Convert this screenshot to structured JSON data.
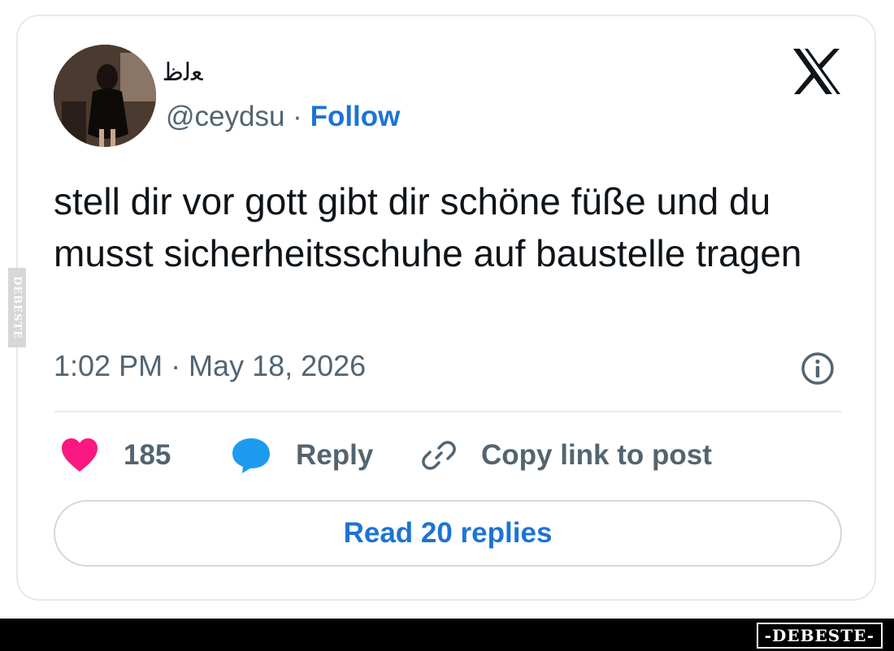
{
  "tweet": {
    "display_name": "ﻌﻟﻇ",
    "handle": "@ceydsu",
    "separator": "·",
    "follow_label": "Follow",
    "text": "stell dir vor gott gibt dir schöne füße und du musst sicherheitsschuhe auf baustelle tragen",
    "timestamp": "1:02 PM · May 18, 2026"
  },
  "actions": {
    "like_count": "185",
    "reply_label": "Reply",
    "copy_label": "Copy link to post",
    "read_replies_label": "Read 20 replies"
  },
  "icons": {
    "logo": "x-logo-icon",
    "info": "info-icon",
    "like": "heart-icon",
    "reply": "speech-bubble-icon",
    "copy": "link-icon"
  },
  "colors": {
    "follow": "#1d74d4",
    "heart": "#f91880",
    "reply": "#1d9bf0",
    "secondary_text": "#536471"
  },
  "watermark": {
    "side": "DEBESTE",
    "bottom": "-DEBESTE-"
  }
}
